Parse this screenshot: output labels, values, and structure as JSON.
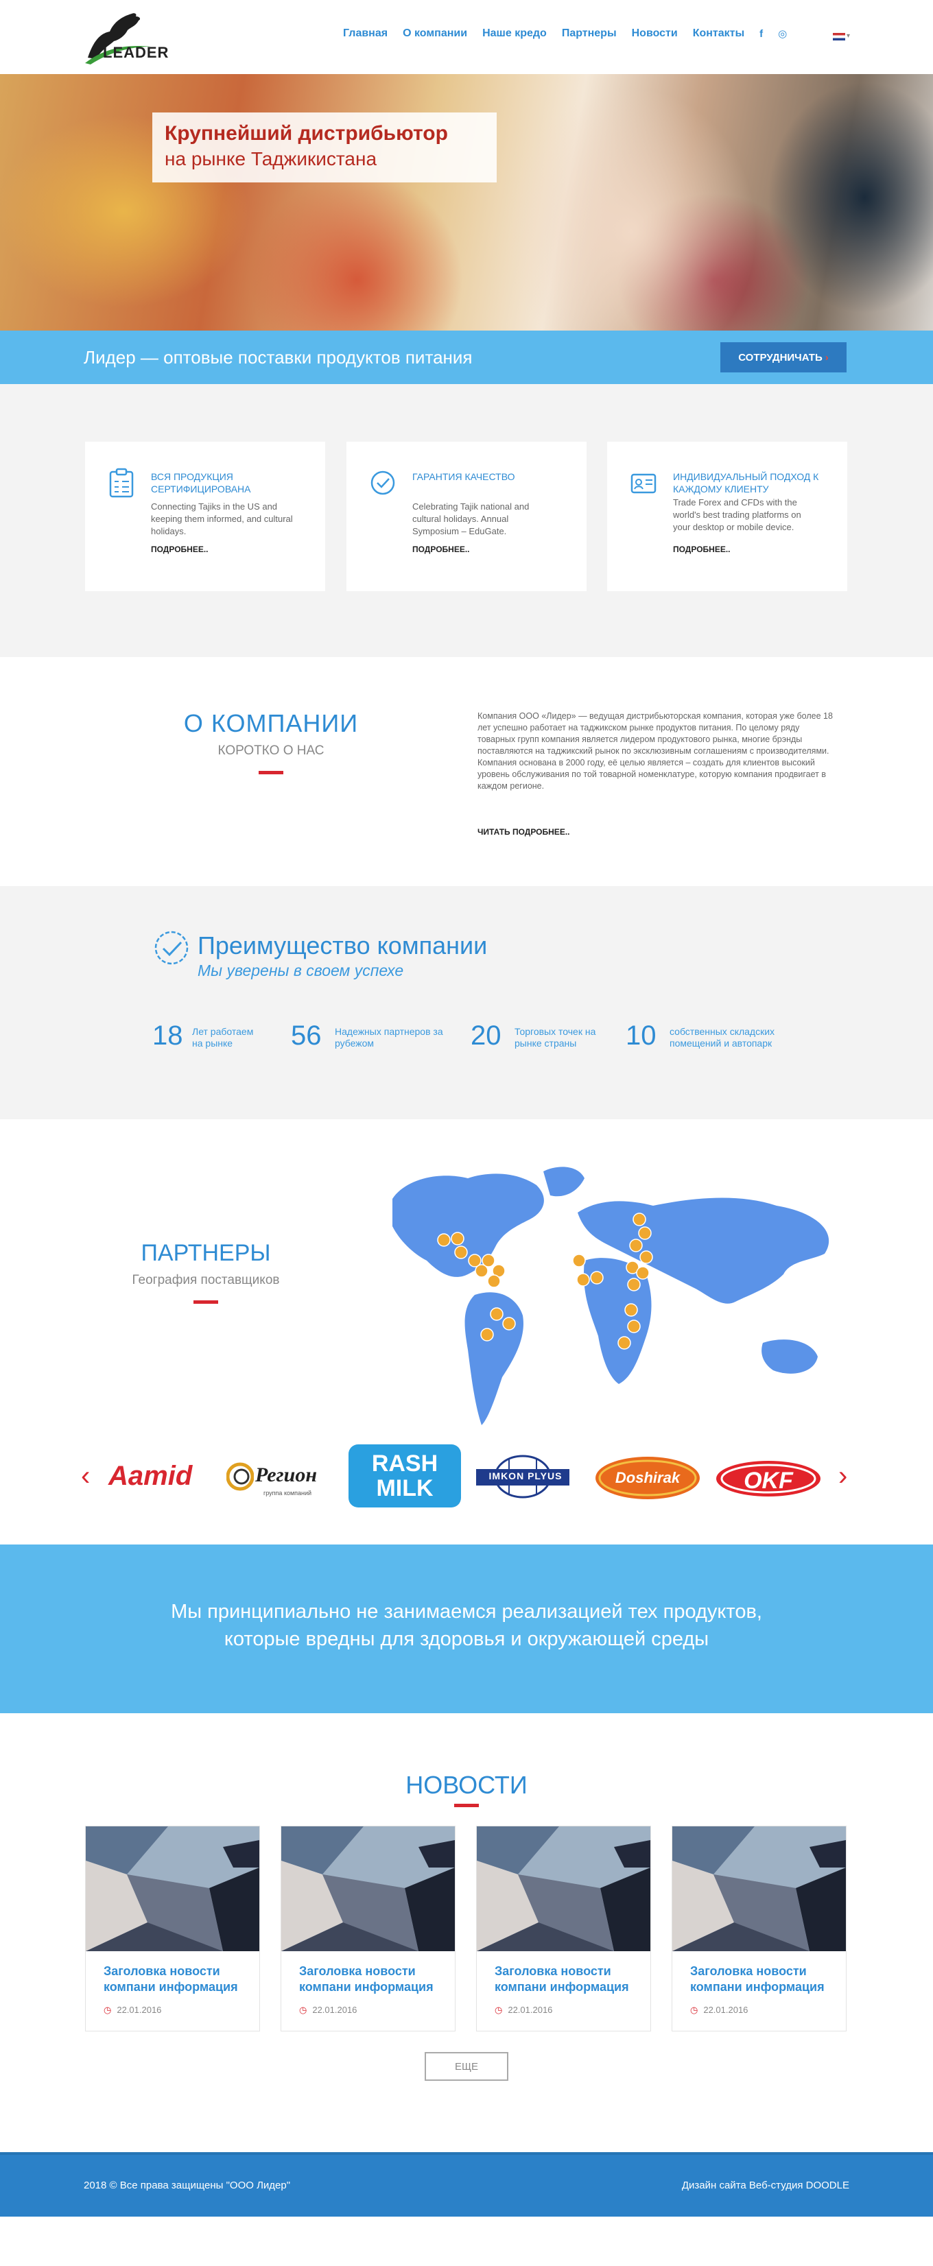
{
  "header": {
    "logo_text": "LEADER",
    "nav": [
      "Главная",
      "О компании",
      "Наше кредо",
      "Партнеры",
      "Новости",
      "Контакты"
    ],
    "social": [
      "f",
      "◎"
    ],
    "language": "en"
  },
  "hero": {
    "line1": "Крупнейший дистрибьютор",
    "line2": "на рынке Таджикистана"
  },
  "banner": {
    "text": "Лидер — оптовые поставки продуктов питания",
    "button": "СОТРУДНИЧАТЬ",
    "button_arrow": "›"
  },
  "features": [
    {
      "title": "ВСЯ ПРОДУКЦИЯ СЕРТИФИЦИРОВАНА",
      "text": "Connecting Tajiks in the US and keeping them informed, and cultural holidays.",
      "more": "ПОДРОБНЕЕ..",
      "icon": "clipboard-icon"
    },
    {
      "title": "ГАРАНТИЯ КАЧЕСТВО",
      "text": "Celebrating Tajik national and cultural holidays. Annual Symposium – EduGate.",
      "more": "ПОДРОБНЕЕ..",
      "icon": "check-circle-icon"
    },
    {
      "title": "ИНДИВИДУАЛЬНЫЙ ПОДХОД К КАЖДОМУ КЛИЕНТУ",
      "text": "Trade Forex and CFDs with the world's best trading platforms on your desktop or mobile device.",
      "more": "ПОДРОБНЕЕ..",
      "icon": "id-card-icon"
    }
  ],
  "about": {
    "title": "О КОМПАНИИ",
    "subtitle": "КОРОТКО О НАС",
    "text": "Компания ООО «Лидер» — ведущая дистрибьюторская компания, которая уже более 18 лет успешно работает на таджикском рынке продуктов питания. По целому ряду товарных групп компания является лидером продуктового рынка, многие брэнды поставляются на таджикский рынок по эксклюзивным соглашениям с производителями. Компания основана в 2000 году, её целью является – создать для клиентов высокий уровень обслуживания по той товарной номенклатуре, которую компания продвигает в каждом регионе.",
    "more": "ЧИТАТЬ ПОДРОБНЕЕ.."
  },
  "advantage": {
    "title": "Преимущество компании",
    "subtitle": "Мы уверены в своем успехе",
    "stats": [
      {
        "number": "18",
        "label": "Лет работаем на рынке"
      },
      {
        "number": "56",
        "label": "Надежных партнеров за рубежом"
      },
      {
        "number": "20",
        "label": "Торговых точек на рынке страны"
      },
      {
        "number": "10",
        "label": "собственных складских помещений и автопарк"
      }
    ]
  },
  "partners": {
    "title": "ПАРТНЕРЫ",
    "subtitle": "География поставщиков"
  },
  "logos": {
    "prev": "‹",
    "next": "›",
    "items": [
      "Aamid",
      "Регион",
      "RASH MILK",
      "IMKON PLYUS",
      "Doshirak",
      "OKF"
    ],
    "region_tagline": "группа компаний"
  },
  "statement": {
    "line1": "Мы принципиально не занимаемся реализацией тех продуктов,",
    "line2": "которые вредны для здоровья и окружающей среды"
  },
  "news": {
    "title": "НОВОСТИ",
    "items": [
      {
        "title": "Заголовка новости компани информация",
        "date": "22.01.2016"
      },
      {
        "title": "Заголовка новости компани информация",
        "date": "22.01.2016"
      },
      {
        "title": "Заголовка новости компани информация",
        "date": "22.01.2016"
      },
      {
        "title": "Заголовка новости компани информация",
        "date": "22.01.2016"
      }
    ],
    "more": "ЕЩЕ"
  },
  "footer": {
    "copyright": "2018 © Все права защищены \"ООО Лидер\"",
    "credit": "Дизайн сайта Веб-студия DOODLE"
  },
  "colors": {
    "accent": "#2e8bd3",
    "light_blue": "#5bb9ed",
    "red": "#d8262f",
    "footer": "#2b81c8"
  }
}
